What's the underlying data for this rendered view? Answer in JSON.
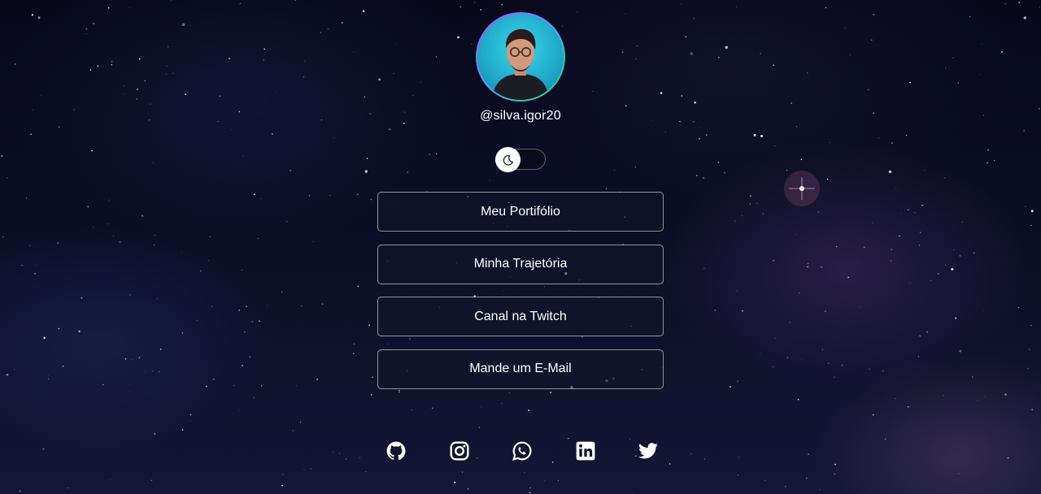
{
  "profile": {
    "username": "@silva.igor20",
    "avatar_icon": "profile-photo"
  },
  "theme_toggle": {
    "icon": "moon-icon",
    "state": "dark"
  },
  "links": [
    {
      "label": "Meu Portifólio"
    },
    {
      "label": "Minha Trajetória"
    },
    {
      "label": "Canal na Twitch"
    },
    {
      "label": "Mande um E-Mail"
    }
  ],
  "socials": [
    {
      "name": "github-icon"
    },
    {
      "name": "instagram-icon"
    },
    {
      "name": "whatsapp-icon"
    },
    {
      "name": "linkedin-icon"
    },
    {
      "name": "twitter-icon"
    }
  ],
  "colors": {
    "background": "#0b0d26",
    "text": "#ffffff",
    "avatar_ring_start": "#c040ff",
    "avatar_ring_end": "#22e07a",
    "avatar_bg": "#1ec8e0"
  }
}
